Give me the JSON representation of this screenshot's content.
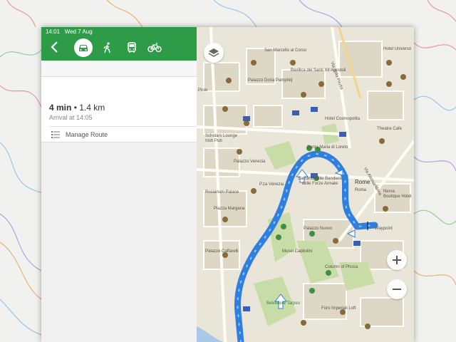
{
  "status_bar": {
    "time": "14:01",
    "date": "Wed 7 Aug"
  },
  "transport_modes": [
    {
      "icon": "car-icon",
      "active": true
    },
    {
      "icon": "walk-icon",
      "active": false
    },
    {
      "icon": "bus-icon",
      "active": false
    },
    {
      "icon": "bike-icon",
      "active": false
    }
  ],
  "route": {
    "duration": "4 min",
    "separator": "•",
    "distance": "1.4 km",
    "arrival": "Arrival at 14:05",
    "manage_label": "Manage Route"
  },
  "map": {
    "labels": [
      "San Marcello al Corso",
      "Palazzo Doria Pamphilj",
      "Basilica dei Santi XII Apostoli",
      "Via della Pilotta",
      "Hotel Cosmopolita",
      "Theatre Cafe",
      "Santa Maria di Loreto",
      "Sacrario delle Bandiere delle Forze Armate",
      "Rome",
      "Roma",
      "P.za Venezia",
      "Palazzo Venezia",
      "Scholars Lounge Irish Pub",
      "Palazzo Nuovo",
      "Musei Capitolini",
      "Column of Phoca",
      "Belvedere Tarpeo",
      "Foro Imperiali Loft",
      "Nerva Boutique Hotel",
      "Hotel Universo",
      "Piazza Margana",
      "Rosianum Palace",
      "Palazzo Caffarelli",
      "Waypoint",
      "Via Alessandrina",
      "Pinio"
    ]
  },
  "colors": {
    "accent": "#2e9b48",
    "route": "#2f7fe0",
    "map_bg": "#e9e6d9",
    "park": "#c8dca8"
  }
}
